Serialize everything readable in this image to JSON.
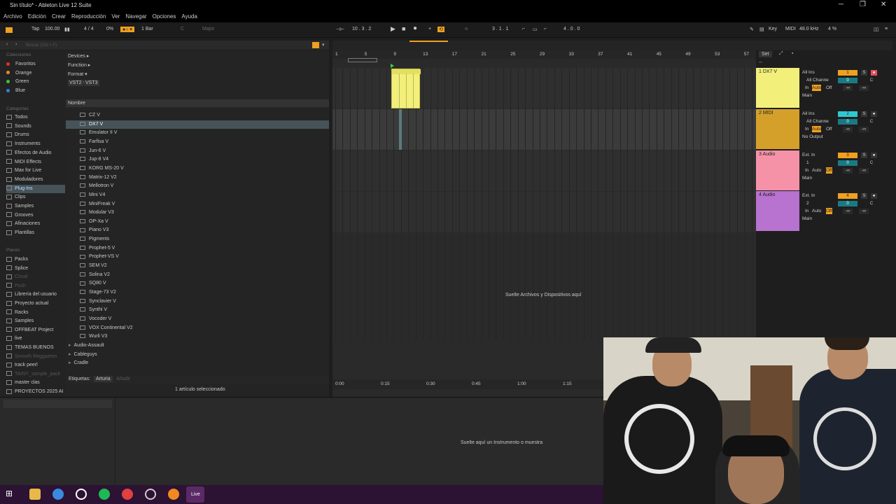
{
  "window": {
    "title": "Sin título* - Ableton Live 12 Suite",
    "controls": [
      "─",
      "❐",
      "✕"
    ]
  },
  "menu": [
    "Archivo",
    "Edición",
    "Crear",
    "Reproducción",
    "Ver",
    "Navegar",
    "Opciones",
    "Ayuda"
  ],
  "control_bar": {
    "tap": "Tap",
    "tempo": "100.00",
    "time_sig": "4 / 4",
    "cpu": "0%",
    "quantize": "1 Bar",
    "key": "C",
    "scale": "Major",
    "position": "10 .  3 .  2",
    "loop_start": "3 .  1 .  1",
    "loop_length": "4 .  0 .  0",
    "key_label": "Key",
    "midi_label": "MIDI",
    "sample_rate": "48.0 kHz",
    "cpu_load": "4 %"
  },
  "browser": {
    "search_placeholder": "Buscar (Ctrl + F)",
    "collections_title": "Colecciones",
    "collections": [
      {
        "label": "Favoritos",
        "color": "#e03030"
      },
      {
        "label": "Orange",
        "color": "#f08a20"
      },
      {
        "label": "Green",
        "color": "#40c040"
      },
      {
        "label": "Blue",
        "color": "#3080e0"
      }
    ],
    "categories_title": "Categorías",
    "categories": [
      "Todos",
      "Sounds",
      "Drums",
      "Instruments",
      "Efectos de Audio",
      "MIDI Effects",
      "Max for Live",
      "Moduladores",
      "Plug-Ins",
      "Clips",
      "Samples",
      "Grooves",
      "Afinaciones",
      "Plantillas"
    ],
    "places_title": "Places",
    "places": [
      "Packs",
      "Splice",
      "Cloud",
      "Push",
      "Librería del usuario",
      "Proyecto actual",
      "Racks",
      "Samples",
      "OFFBEAT Project",
      "live",
      "TEMAS BUENOS",
      "Smooth Reggaeton",
      "track peerl",
      "TAINY_sample_pack",
      "master clas",
      "PROYECTOS 2025 AI"
    ],
    "filters": [
      "Devices ▸",
      "Function ▸",
      "Format ▾",
      "Creator ▸"
    ],
    "formats": [
      "VST2",
      "VST3"
    ],
    "column_name": "Nombre",
    "files": [
      "CZ V",
      "DX7 V",
      "Emulator II V",
      "Farfisa V",
      "Jun-6 V",
      "Jup-8 V4",
      "KORG MS-20 V",
      "Matrix-12 V2",
      "Mellotron V",
      "Mini V4",
      "MiniFreak V",
      "Modular V3",
      "OP-Xa V",
      "Piano V3",
      "Pigments",
      "Prophet-5 V",
      "Prophet-VS V",
      "SEM V2",
      "Solina V2",
      "SQ80 V",
      "Stage-73 V2",
      "Synclavier V",
      "Synthi V",
      "Vocoder V",
      "VOX Continental V2",
      "Wurli V3"
    ],
    "folders": [
      "Audio-Assault",
      "Cableguys",
      "Cradle"
    ],
    "tags_label": "Etiquetas:",
    "tag": "Arturia",
    "tag_add": "Añadir",
    "status": "1 artículo seleccionado"
  },
  "ruler": [
    "1",
    "5",
    "9",
    "13",
    "17",
    "21",
    "25",
    "29",
    "33",
    "37",
    "41",
    "45",
    "49",
    "53",
    "57"
  ],
  "time_ruler": [
    "0:00",
    "0:15",
    "0:30",
    "0:45",
    "1:00",
    "1:15"
  ],
  "drop_hint": "Suelte Archivos y Dispositivos aquí",
  "set_label": "Set",
  "tracks": [
    {
      "name": "1 DX7 V",
      "color": "#f2f07a",
      "num": "1",
      "input": "All Ins",
      "channel": "All Channe",
      "mon": [
        "In",
        "Auto",
        "Off"
      ],
      "output": "Main"
    },
    {
      "name": "2 MIDI",
      "color": "#d4a02a",
      "num": "2",
      "input": "All Ins",
      "channel": "All Channe",
      "mon": [
        "In",
        "Auto",
        "Off"
      ],
      "output": "No Output"
    },
    {
      "name": "3 Audio",
      "color": "#f592a8",
      "num": "3",
      "input": "Ext. In",
      "channel": "1",
      "mon": [
        "In",
        "Auto",
        "Off"
      ],
      "output": "Main"
    },
    {
      "name": "4 Audio",
      "color": "#b872cf",
      "num": "4",
      "input": "Ext. In",
      "channel": "2",
      "mon": [
        "In",
        "Auto",
        "Off"
      ],
      "output": "Main"
    }
  ],
  "track_values": {
    "vol": "0",
    "pan": "C",
    "send": "-∞",
    "solo": "S"
  },
  "detail_hint": "Suelte aquí un Instrumento o muestra",
  "taskbar": {
    "live_label": "Live"
  }
}
